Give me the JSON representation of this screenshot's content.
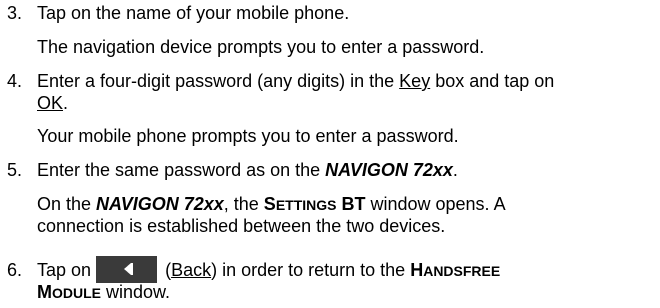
{
  "steps": [
    {
      "number": "3.",
      "instruction": "Tap on the name of your mobile phone.",
      "result": "The navigation device prompts you to enter a password."
    },
    {
      "number": "4.",
      "instruction_part1": "Enter a four-digit password (any digits) in the ",
      "key_label": "Key",
      "instruction_part2": " box and tap on",
      "ok_label": "OK",
      "ok_suffix": ".",
      "result": "Your mobile phone prompts you to enter a password."
    },
    {
      "number": "5.",
      "instruction_prefix": "Enter the same password as on the ",
      "device_name": "NAVIGON 72xx",
      "instruction_suffix": ".",
      "result_prefix": "On the ",
      "result_device": "NAVIGON 72xx",
      "result_mid": ", the ",
      "settings_cap_S": "S",
      "settings_small": "ETTINGS",
      "settings_bt": " BT",
      "result_after": " window opens. A",
      "result_line2": "connection is established between the two devices."
    },
    {
      "number": "6.",
      "tap_on": "Tap on",
      "back_open": "(",
      "back_label": "Back",
      "back_close": ")",
      "instruction_mid": " in order to return to the ",
      "handsfree_cap_H": "H",
      "handsfree_small": "ANDSFREE",
      "module_cap_M": "M",
      "module_small": "ODULE",
      "window_word": " window."
    }
  ],
  "colors": {
    "text": "#000000",
    "background": "#ffffff",
    "back_button": "#3a3a3a"
  },
  "icons": {
    "back_button_icon": "back-arrow-icon"
  }
}
